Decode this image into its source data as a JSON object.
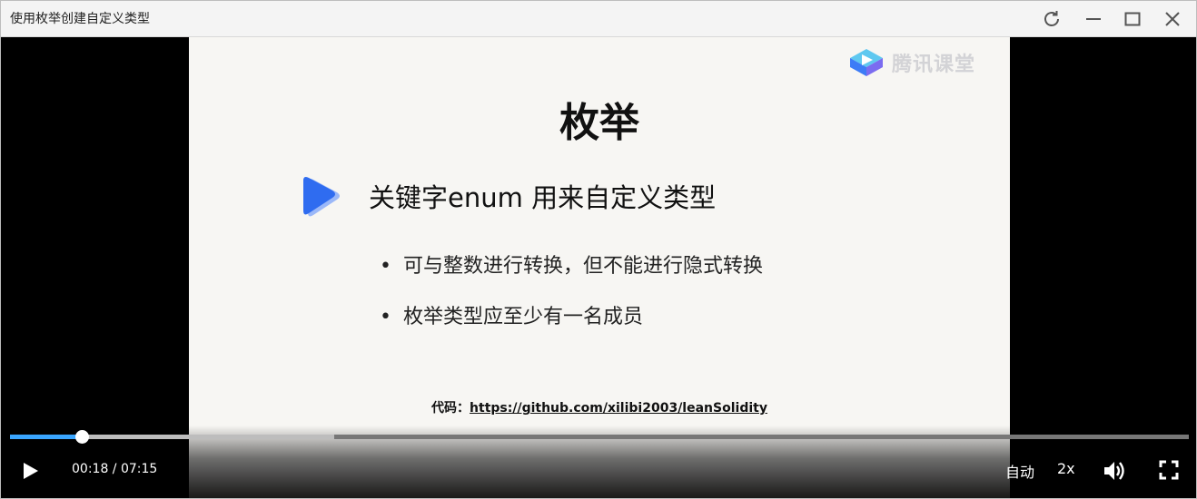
{
  "window": {
    "title": "使用枚举创建自定义类型"
  },
  "slide": {
    "logo_text": "腾讯课堂",
    "title": "枚举",
    "subheading": "关键字enum 用来自定义类型",
    "bullets": [
      {
        "marker": "•",
        "text": "可与整数进行转换，但不能进行隐式转换"
      },
      {
        "marker": "•",
        "text": "枚举类型应至少有一名成员"
      }
    ],
    "code_label": "代码：",
    "code_url": "https://github.com/xilibi2003/leanSolidity"
  },
  "player": {
    "current_time": "00:18",
    "duration": "07:15",
    "time_separator": " / ",
    "progress_fraction": 0.061,
    "buffered_fraction": 0.275,
    "quality_label": "自动",
    "speed_label": "2x"
  },
  "colors": {
    "progress": "#3aa6ff",
    "logo_blue": "#3d7cf6"
  },
  "icons": [
    "refresh-icon",
    "minimize-icon",
    "maximize-icon",
    "close-icon",
    "play-icon",
    "volume-icon",
    "fullscreen-icon",
    "tencent-classroom-logo-icon",
    "play-bullet-icon"
  ]
}
